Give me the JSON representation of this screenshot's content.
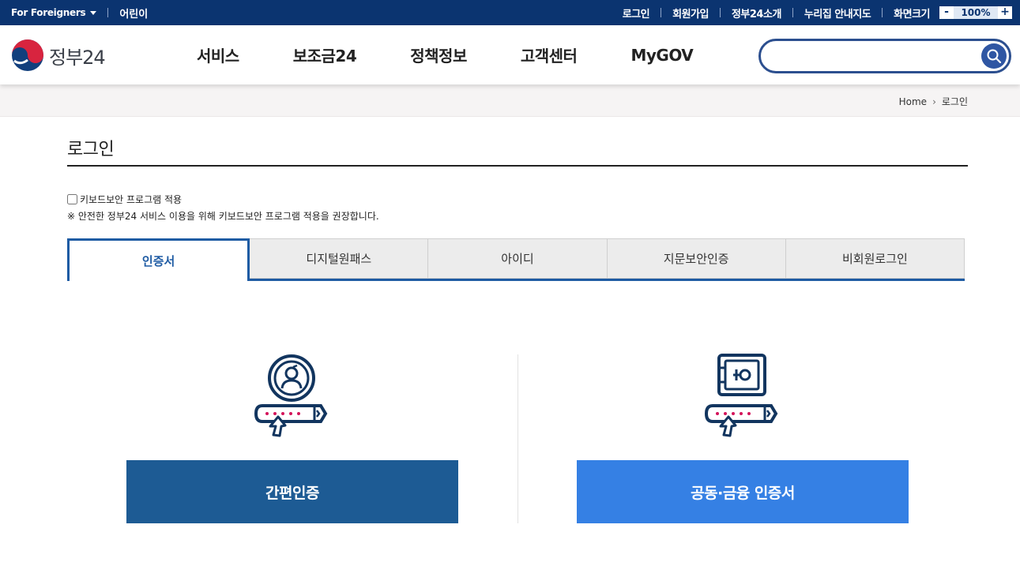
{
  "topbar": {
    "foreigners": "For Foreigners",
    "kids": "어린이",
    "links": [
      "로그인",
      "회원가입",
      "정부24소개",
      "누리집 안내지도"
    ],
    "zoom_label": "화면크기",
    "zoom_minus": "-",
    "zoom_value": "100%",
    "zoom_plus": "+"
  },
  "header": {
    "logo_text": "정부24",
    "nav": [
      "서비스",
      "보조금24",
      "정책정보",
      "고객센터",
      "MyGOV"
    ],
    "search_placeholder": ""
  },
  "breadcrumb": {
    "home": "Home",
    "current": "로그인"
  },
  "page_title": "로그인",
  "keyboard": {
    "checkbox_label": "키보드보안 프로그램 적용",
    "note": "※ 안전한 정부24 서비스 이용을 위해 키보드보안 프로그램 적용을 권장합니다."
  },
  "tabs": [
    "인증서",
    "디지털원패스",
    "아이디",
    "지문보안인증",
    "비회원로그인"
  ],
  "auth": {
    "simple_label": "간편인증",
    "joint_label": "공동·금융 인증서"
  },
  "colors": {
    "topbar": "#0b3470",
    "accent": "#1e5ba3",
    "simple_button": "#1d5b94",
    "joint_button": "#3580e4",
    "password_dots": "#d4145a"
  },
  "icons": [
    "caret-down-icon",
    "search-icon",
    "chevron-right-icon",
    "user-circle-icon",
    "password-field-icon",
    "cursor-arrow-icon",
    "safe-icon"
  ]
}
